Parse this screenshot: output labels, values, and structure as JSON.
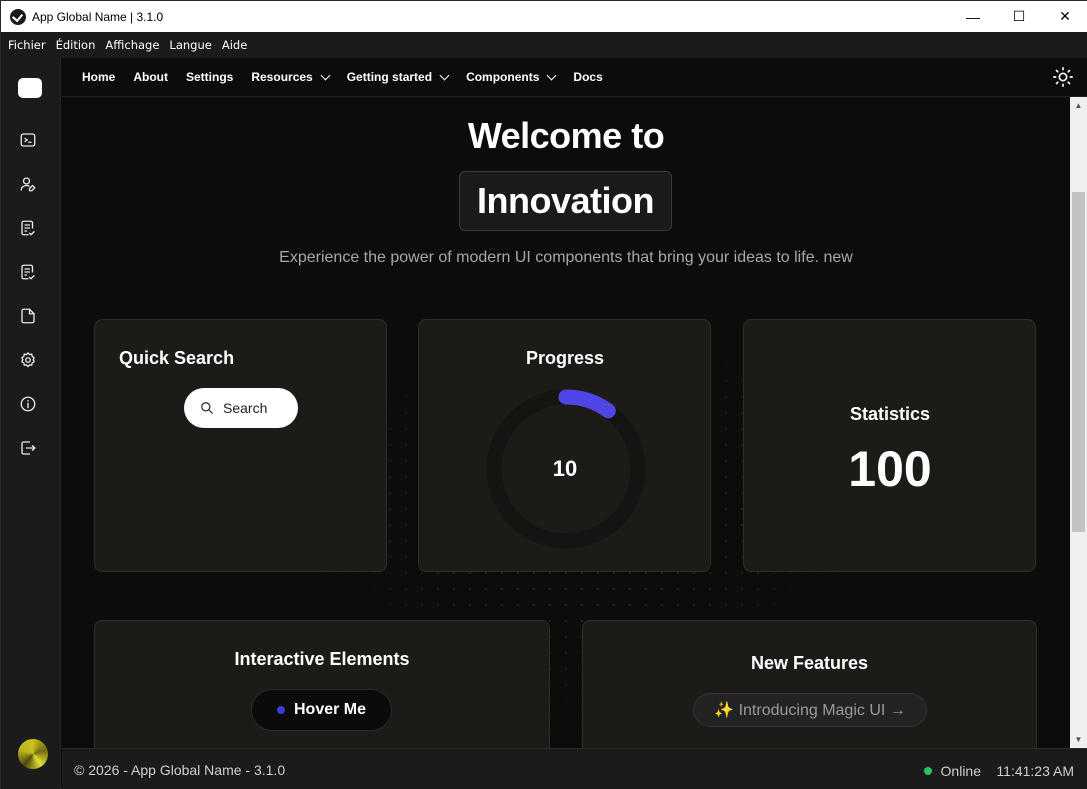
{
  "window": {
    "title": "App Global Name | 3.1.0",
    "controls": {
      "minimize": "—",
      "maximize": "☐",
      "close": "✕"
    }
  },
  "menubar": {
    "items": [
      "Fichier",
      "Édition",
      "Affichage",
      "Langue",
      "Aide"
    ]
  },
  "sidebar": {
    "icons": [
      "terminal-icon",
      "user-edit-icon",
      "clipboard-check-icon",
      "clipboard-check-icon",
      "file-icon",
      "settings-icon",
      "info-icon",
      "logout-icon"
    ]
  },
  "nav": {
    "items": [
      {
        "label": "Home",
        "dropdown": false
      },
      {
        "label": "About",
        "dropdown": false
      },
      {
        "label": "Settings",
        "dropdown": false
      },
      {
        "label": "Resources",
        "dropdown": true
      },
      {
        "label": "Getting started",
        "dropdown": true
      },
      {
        "label": "Components",
        "dropdown": true
      },
      {
        "label": "Docs",
        "dropdown": false
      }
    ],
    "theme_icon": "sun-icon"
  },
  "hero": {
    "title": "Welcome to",
    "highlight": "Innovation",
    "subtitle": "Experience the power of modern UI components that bring your ideas to life. new"
  },
  "cards": {
    "search": {
      "title": "Quick Search",
      "button_label": "Search"
    },
    "progress": {
      "title": "Progress",
      "value": "10",
      "percent": 10,
      "color": "#4f46e5"
    },
    "statistics": {
      "title": "Statistics",
      "value": "100"
    },
    "interactive": {
      "title": "Interactive Elements",
      "button_label": "Hover Me"
    },
    "features": {
      "title": "New Features",
      "pill_label": "✨ Introducing Magic UI →"
    }
  },
  "footer": {
    "copyright": "© 2026 - App Global Name - 3.1.0",
    "status": "Online",
    "status_color": "#22c55e",
    "time": "11:41:23 AM"
  }
}
